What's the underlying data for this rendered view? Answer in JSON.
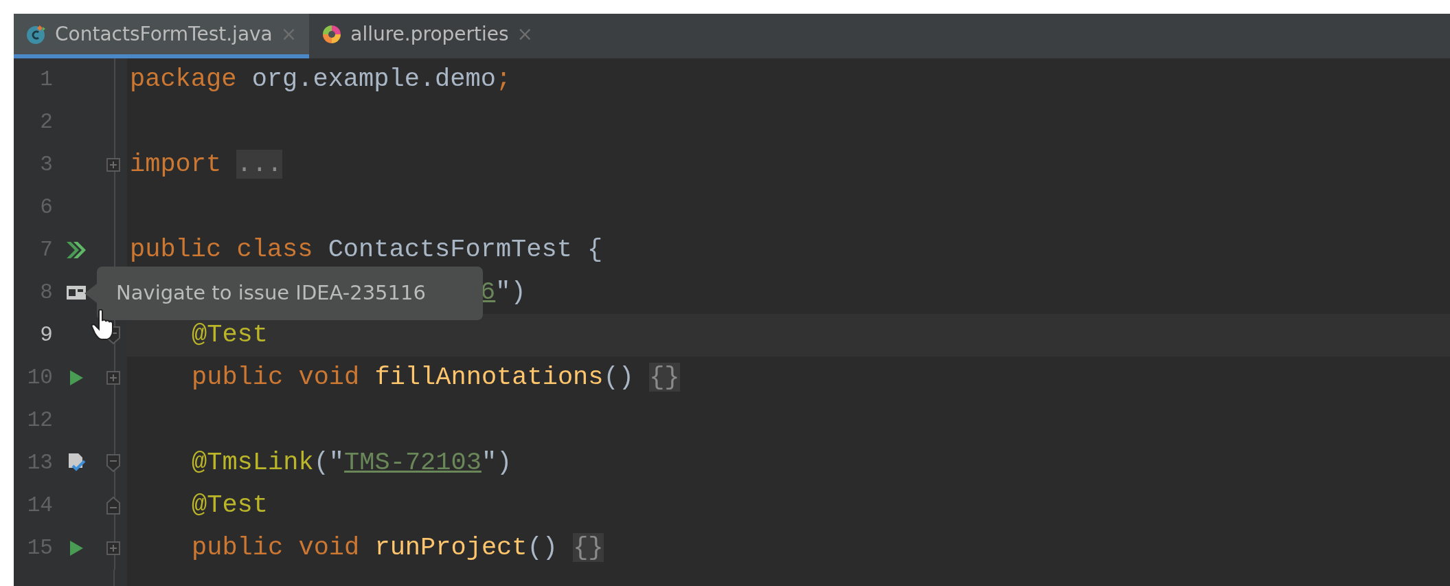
{
  "tabs": [
    {
      "label": "ContactsFormTest.java",
      "close": "×",
      "selected": true
    },
    {
      "label": "allure.properties",
      "close": "×",
      "selected": false
    }
  ],
  "lines": [
    {
      "number": "1",
      "tokens": [
        {
          "kind": "keyword",
          "text": "package"
        },
        {
          "kind": "plain",
          "text": " org.example.demo"
        },
        {
          "kind": "keyword",
          "text": ";"
        }
      ]
    },
    {
      "number": "2"
    },
    {
      "number": "3",
      "fold": {
        "kind": "plus"
      },
      "tokens": [
        {
          "kind": "keyword",
          "text": "import"
        },
        {
          "kind": "folded",
          "text": "..."
        }
      ]
    },
    {
      "number": "6"
    },
    {
      "number": "7",
      "marker": {
        "kind": "run-all"
      },
      "tokens": [
        {
          "kind": "keyword",
          "text": "public class"
        },
        {
          "kind": "plain",
          "text": " ContactsFormTest {"
        }
      ]
    },
    {
      "number": "8",
      "marker": {
        "kind": "issue"
      },
      "indent": true,
      "covered": true,
      "tokens": [
        {
          "kind": "link",
          "text": "6"
        },
        {
          "kind": "plain",
          "text": "\")"
        }
      ]
    },
    {
      "number": "9",
      "current": true,
      "fold": {
        "kind": "minus-start"
      },
      "indent": true,
      "tokens": [
        {
          "kind": "annotation",
          "text": "@Test"
        }
      ]
    },
    {
      "number": "10",
      "marker": {
        "kind": "run"
      },
      "fold": {
        "kind": "plus"
      },
      "indent": true,
      "tokens": [
        {
          "kind": "keyword",
          "text": "public void "
        },
        {
          "kind": "method",
          "text": "fillAnnotations"
        },
        {
          "kind": "plain",
          "text": "() "
        },
        {
          "kind": "folded",
          "text": "{}"
        }
      ]
    },
    {
      "number": "12"
    },
    {
      "number": "13",
      "marker": {
        "kind": "tms"
      },
      "fold": {
        "kind": "minus-start"
      },
      "indent": true,
      "tokens": [
        {
          "kind": "annotation",
          "text": "@TmsLink"
        },
        {
          "kind": "plain",
          "text": "(\""
        },
        {
          "kind": "link",
          "text": "TMS-72103"
        },
        {
          "kind": "plain",
          "text": "\")"
        }
      ]
    },
    {
      "number": "14",
      "fold": {
        "kind": "minus-end"
      },
      "indent": true,
      "tokens": [
        {
          "kind": "annotation",
          "text": "@Test"
        }
      ]
    },
    {
      "number": "15",
      "marker": {
        "kind": "run"
      },
      "fold": {
        "kind": "plus"
      },
      "indent": true,
      "tokens": [
        {
          "kind": "keyword",
          "text": "public void "
        },
        {
          "kind": "method",
          "text": "runProject"
        },
        {
          "kind": "plain",
          "text": "() "
        },
        {
          "kind": "folded",
          "text": "{}"
        }
      ]
    }
  ],
  "tooltip": {
    "text": "Navigate to issue IDEA-235116"
  }
}
